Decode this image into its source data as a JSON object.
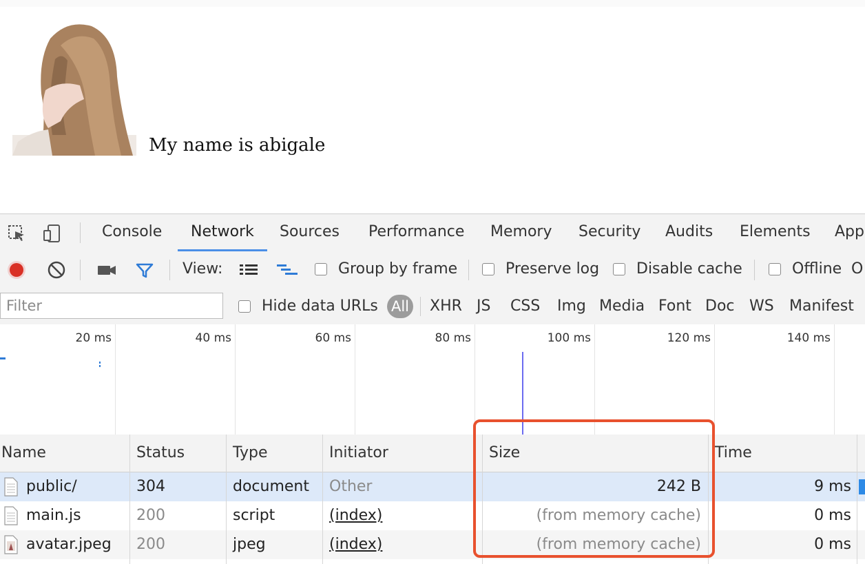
{
  "page": {
    "text": "My name is abigale"
  },
  "devtools": {
    "tabs": [
      "Console",
      "Network",
      "Sources",
      "Performance",
      "Memory",
      "Security",
      "Audits",
      "Elements",
      "App"
    ],
    "active_tab": "Network",
    "toolbar": {
      "view_label": "View:",
      "group_by_frame": "Group by frame",
      "preserve_log": "Preserve log",
      "disable_cache": "Disable cache",
      "offline": "Offline",
      "overflow": "O"
    },
    "filter": {
      "placeholder": "Filter",
      "hide_data_urls": "Hide data URLs",
      "all": "All",
      "types": [
        "XHR",
        "JS",
        "CSS",
        "Img",
        "Media",
        "Font",
        "Doc",
        "WS",
        "Manifest"
      ]
    },
    "timeline": {
      "ticks": [
        "20 ms",
        "40 ms",
        "60 ms",
        "80 ms",
        "100 ms",
        "120 ms",
        "140 ms"
      ]
    },
    "table": {
      "headers": [
        "Name",
        "Status",
        "Type",
        "Initiator",
        "Size",
        "Time"
      ],
      "rows": [
        {
          "name": "public/",
          "status": "304",
          "type": "document",
          "initiator": "Other",
          "size": "242 B",
          "time": "9 ms",
          "icon": "document-icon"
        },
        {
          "name": "main.js",
          "status": "200",
          "type": "script",
          "initiator": "(index)",
          "size": "(from memory cache)",
          "time": "0 ms",
          "icon": "document-icon"
        },
        {
          "name": "avatar.jpeg",
          "status": "200",
          "type": "jpeg",
          "initiator": "(index)",
          "size": "(from memory cache)",
          "time": "0 ms",
          "icon": "image-icon"
        }
      ]
    }
  },
  "colors": {
    "accent": "#4a8fe7",
    "record": "#d93025",
    "highlight": "#e8512e",
    "selected_row": "#dde9f9"
  }
}
